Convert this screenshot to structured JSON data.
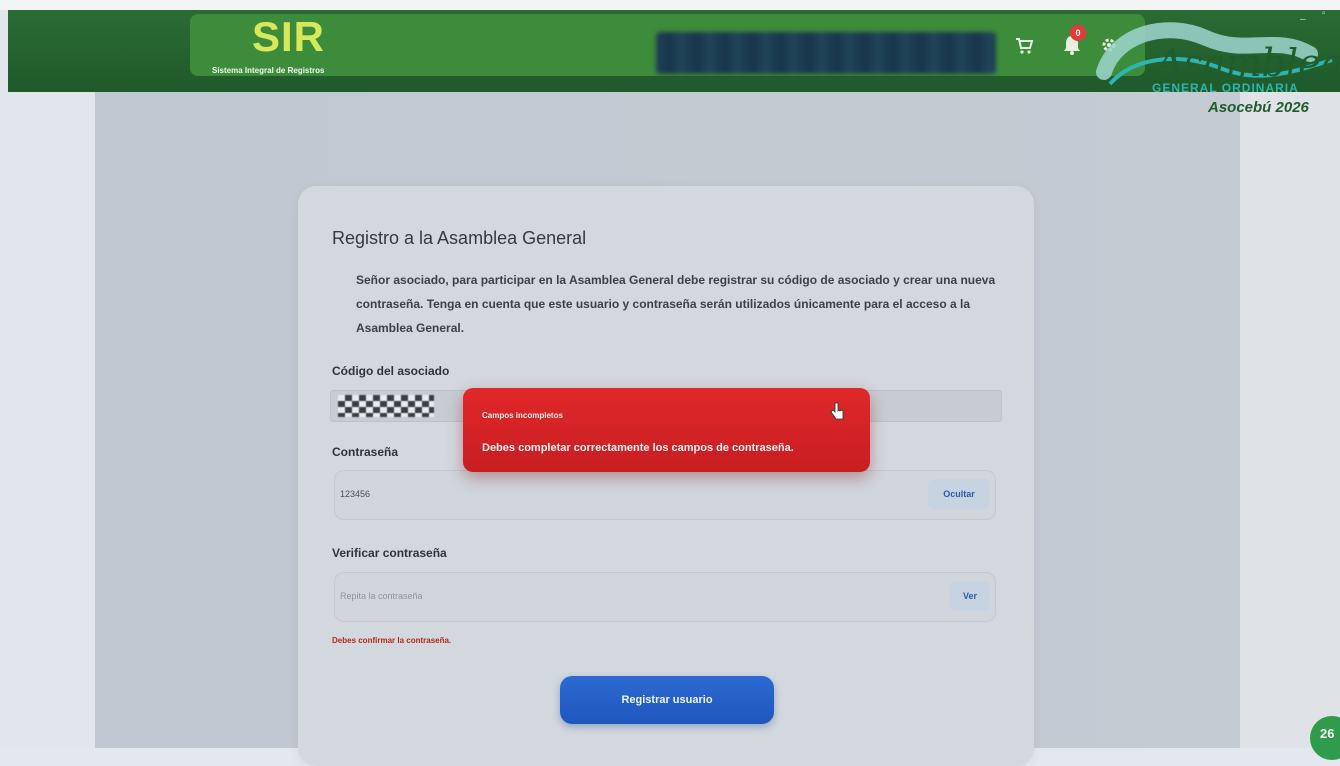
{
  "header": {
    "logo_title": "SIR",
    "logo_subtitle": "Sistema Integral de Registros",
    "notification_count": "0",
    "event_logo": {
      "script_text": "Asamblea",
      "line1": "GENERAL ORDINARIA",
      "line2": "Asocebú 2026"
    },
    "icons": [
      "cart-icon",
      "bell-icon",
      "gear-icon"
    ]
  },
  "form": {
    "title": "Registro a la Asamblea General",
    "intro": "Señor asociado, para participar en la Asamblea General debe registrar su código de asociado y crear una nueva contraseña. Tenga en cuenta que este usuario y contraseña serán utilizados únicamente para el acceso a la Asamblea General.",
    "code_label": "Código del asociado",
    "password_label": "Contraseña",
    "password_value": "123456",
    "hide_button": "Ocultar",
    "verify_label": "Verificar contraseña",
    "verify_placeholder": "Repita la contraseña",
    "view_button": "Ver",
    "verify_error": "Debes confirmar la contraseña.",
    "submit_button": "Registrar usuario"
  },
  "toast": {
    "title": "Campos incompletos",
    "message": "Debes completar correctamente los campos de contraseña."
  },
  "corner_badge": "26",
  "colors": {
    "header_green": "#1f5a2a",
    "logo_yellow": "#d7e85a",
    "toast_red": "#d32325",
    "primary_blue": "#1f57bd",
    "error_red": "#b3261e"
  }
}
